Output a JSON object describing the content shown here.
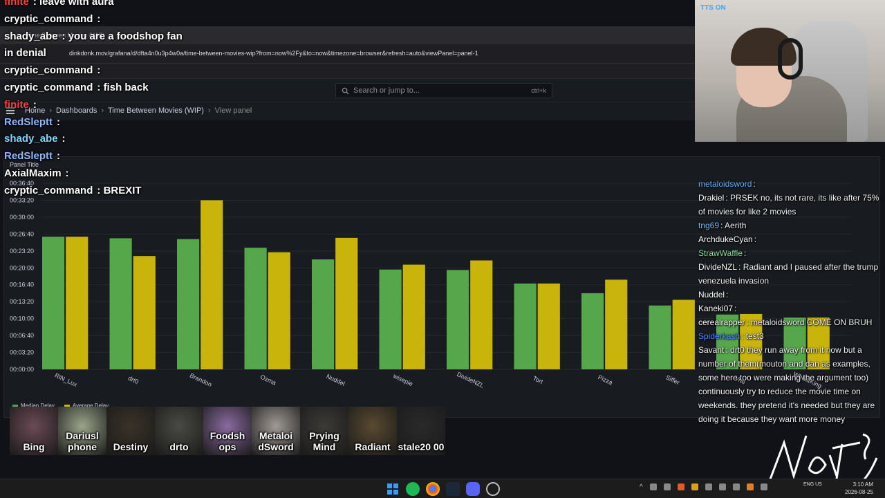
{
  "browser": {
    "tab_label": "Time Between Movies (WIP)",
    "url": "dinkdonk.mov/grafana/d/dfta4n0u3p4w0a/time-between-movies-wip?from=now%2Fy&to=now&timezone=browser&refresh=auto&viewPanel=panel-1"
  },
  "grafana": {
    "search_placeholder": "Search or jump to...",
    "search_shortcut": "ctrl+k",
    "breadcrumbs": [
      "Home",
      "Dashboards",
      "Time Between Movies (WIP)",
      "View panel"
    ],
    "panel_title": "Panel Title",
    "legend": [
      "Median Delay",
      "Average Delay"
    ],
    "colors": {
      "median": "#56a64b",
      "average": "#c8b40a"
    }
  },
  "chart_data": {
    "type": "bar",
    "title": "Panel Title",
    "categories": [
      "RiN_Lux",
      "drt0",
      "Brandon",
      "Ozma",
      "Nuddel",
      "wisepie",
      "DivideNZL",
      "Tort",
      "Pizza",
      "Siffer",
      "Vrai",
      "WheatKing"
    ],
    "series": [
      {
        "name": "Median Delay",
        "values": [
          1568,
          1550,
          1540,
          1438,
          1300,
          1180,
          1175,
          1015,
          900,
          755,
          648,
          612
        ]
      },
      {
        "name": "Average Delay",
        "values": [
          1568,
          1340,
          2000,
          1385,
          1555,
          1238,
          1288,
          1015,
          1060,
          822,
          655,
          612
        ]
      }
    ],
    "y_ticks": [
      "00:00:00",
      "00:03:20",
      "00:06:40",
      "00:10:00",
      "00:13:20",
      "00:16:40",
      "00:20:00",
      "00:23:20",
      "00:26:40",
      "00:30:00",
      "00:33:20",
      "00:36:40"
    ],
    "ylim": [
      0,
      2200
    ],
    "unit": "seconds",
    "legend_position": "bottom-left"
  },
  "chat_top": [
    {
      "user": "finite",
      "color": "#ff4040",
      "text": "leave with aura"
    },
    {
      "user": "cryptic_command",
      "color": "#ffffff",
      "text": ""
    },
    {
      "user": "shady_abe",
      "color": "#ffffff",
      "text": "you are a foodshop fan"
    },
    {
      "user": "in denial",
      "color": "#ffffff",
      "text": ""
    },
    {
      "user": "cryptic_command",
      "color": "#ffffff",
      "text": ""
    },
    {
      "user": "cryptic_command",
      "color": "#ffffff",
      "text": "fish back"
    },
    {
      "user": "finite",
      "color": "#ff4040",
      "text": ""
    },
    {
      "user": "RedSleptt",
      "color": "#8fb8ff",
      "text": ""
    },
    {
      "user": "shady_abe",
      "color": "#7fd7ff",
      "text": ""
    },
    {
      "user": "RedSleptt",
      "color": "#8fb8ff",
      "text": ""
    },
    {
      "user": "AxialMaxim",
      "color": "#ffffff",
      "text": ""
    },
    {
      "user": "cryptic_command",
      "color": "#ffffff",
      "text": "BREXIT"
    }
  ],
  "chat_right": [
    {
      "user": "metaloidsword",
      "color": "#5fb4ff",
      "text": ""
    },
    {
      "user": "Drakiel",
      "color": "#ffffff",
      "text": "PRSEK no, its not rare, its like after 75% of movies for like 2 movies"
    },
    {
      "user": "tng69",
      "color": "#7ab8ff",
      "text": "Aerith"
    },
    {
      "user": "ArchdukeCyan",
      "color": "#ffffff",
      "text": ""
    },
    {
      "user": "StrawWaffle",
      "color": "#7fe0a0",
      "text": ""
    },
    {
      "user": "DivideNZL",
      "color": "#ffffff",
      "text": "Radiant and I paused after the trump venezuela invasion"
    },
    {
      "user": "Nuddel",
      "color": "#ffffff",
      "text": ""
    },
    {
      "user": "Kaneki07",
      "color": "#ffffff",
      "text": ""
    },
    {
      "user": "cerealrapper",
      "color": "#ffffff",
      "text": "metaloidsword COME ON BRUH"
    },
    {
      "user": "Spiderkash",
      "color": "#4a90ff",
      "text": "test3"
    },
    {
      "user": "Savant",
      "color": "#ffffff",
      "text": "drt0 they run away from it now but a number of them(mouton and dan as examples, some here too were making the argument too) continuously try to reduce the movie time on weekends. they pretend it's needed but they are doing it because they want more money"
    }
  ],
  "avatars": [
    {
      "name": "Bing",
      "bg": "#6b4a55"
    },
    {
      "name": "Dariusl phone",
      "bg": "#9aa58a"
    },
    {
      "name": "Destiny",
      "bg": "#3a3228"
    },
    {
      "name": "drto",
      "bg": "#4a4a44"
    },
    {
      "name": "Foodsh ops",
      "bg": "#8a6aa0"
    },
    {
      "name": "Metaloi dSword",
      "bg": "#a09a94"
    },
    {
      "name": "Prying Mind",
      "bg": "#3c3a36"
    },
    {
      "name": "Radiant",
      "bg": "#5a4a30"
    },
    {
      "name": "stale20 00",
      "bg": "#2a2a2a"
    }
  ],
  "webcam": {
    "logo": "TTS ON"
  },
  "taskbar": {
    "lang": "ENG US",
    "time": "3:10 AM",
    "date": "2026-08-25"
  }
}
